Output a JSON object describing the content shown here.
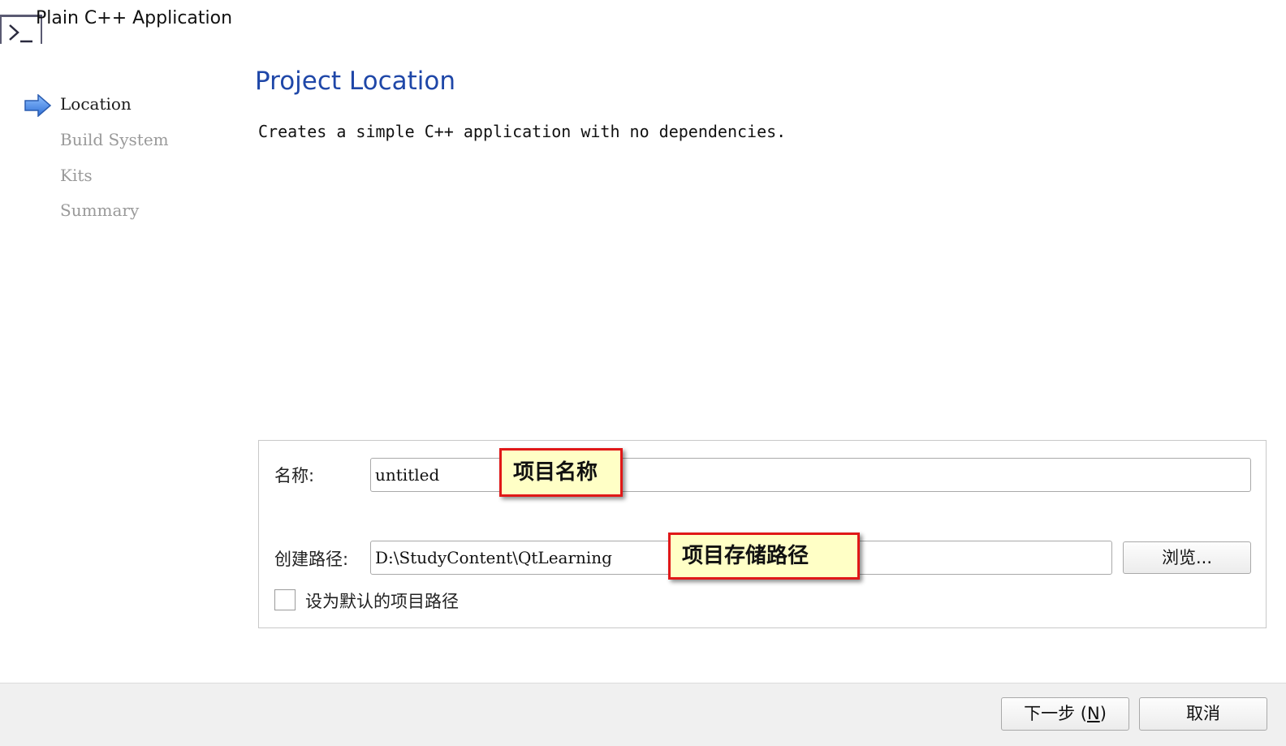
{
  "window": {
    "title": "Plain C++ Application",
    "icon": "terminal-icon"
  },
  "steps": [
    {
      "label": "Location",
      "current": true
    },
    {
      "label": "Build System",
      "current": false
    },
    {
      "label": "Kits",
      "current": false
    },
    {
      "label": "Summary",
      "current": false
    }
  ],
  "current_step_icon": "right-arrow-icon",
  "page": {
    "title": "Project Location",
    "description": "Creates a simple C++ application with no dependencies."
  },
  "form": {
    "name_label": "名称:",
    "name_value": "untitled",
    "path_label": "创建路径:",
    "path_value": "D:\\StudyContent\\QtLearning",
    "browse_label": "浏览...",
    "default_checkbox_label": "设为默认的项目路径",
    "default_checked": false
  },
  "annotations": {
    "name_note": "项目名称",
    "path_note": "项目存储路径"
  },
  "footer": {
    "next_label_prefix": "下一步 (",
    "next_mnemonic": "N",
    "next_label_suffix": ")",
    "cancel_label": "取消"
  },
  "colors": {
    "title_blue": "#1f47a8",
    "annotation_fill": "#ffffc6",
    "annotation_border": "#e01818",
    "arrow_blue": "#3f86e8"
  }
}
